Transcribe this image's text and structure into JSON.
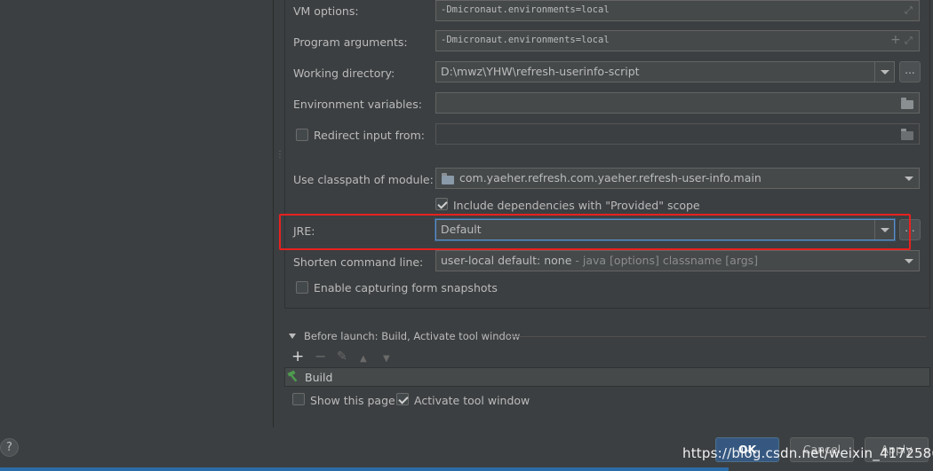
{
  "config": {
    "vm_options": {
      "label": "VM options:",
      "value": "-Dmicronaut.environments=local"
    },
    "program_arguments": {
      "label": "Program arguments:",
      "value": "-Dmicronaut.environments=local"
    },
    "working_directory": {
      "label": "Working directory:",
      "value": "D:\\mwz\\YHW\\refresh-userinfo-script",
      "browse_label": "..."
    },
    "environment_variables": {
      "label": "Environment variables:",
      "value": ""
    },
    "redirect_input": {
      "label": "Redirect input from:",
      "checked": false,
      "value": ""
    },
    "classpath_module": {
      "label": "Use classpath of module:",
      "value": "com.yaeher.refresh.com.yaeher.refresh-user-info.main"
    },
    "include_provided": {
      "label": "Include dependencies with \"Provided\" scope",
      "checked": true
    },
    "jre": {
      "label": "JRE:",
      "value": "Default",
      "browse_label": "..."
    },
    "shorten_command_line": {
      "label": "Shorten command line:",
      "value": "user-local default: none",
      "hint": " - java [options] classname [args]"
    },
    "capture_snapshots": {
      "label": "Enable capturing form snapshots",
      "checked": false
    }
  },
  "before_launch": {
    "title": "Before launch: Build, Activate tool window",
    "toolbar": {
      "add": "+",
      "remove": "−",
      "edit": "✎",
      "up": "▲",
      "down": "▼"
    },
    "items": [
      {
        "label": "Build"
      }
    ],
    "show_this_page": {
      "label": "Show this page",
      "checked": false
    },
    "activate_tool_window": {
      "label": "Activate tool window",
      "checked": true
    }
  },
  "footer": {
    "help": "?",
    "ok": "OK",
    "cancel": "Cancel",
    "apply": "Apply"
  },
  "watermark": "https://blog.csdn.net/weixin_41725862",
  "colors": {
    "highlight": "#e8201f",
    "primary_button": "#365880",
    "background": "#3c3f41"
  }
}
